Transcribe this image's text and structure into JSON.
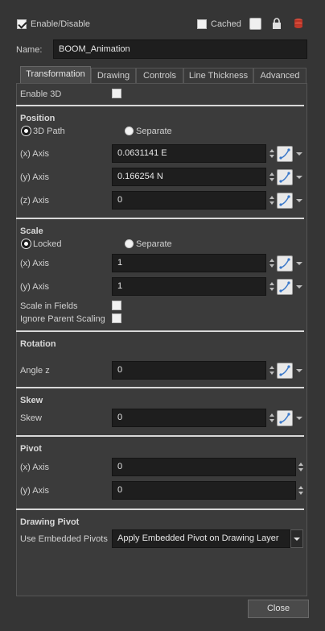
{
  "header": {
    "enable_label": "Enable/Disable",
    "enable_checked": true,
    "cached_label": "Cached"
  },
  "name": {
    "label": "Name:",
    "value": "BOOM_Animation"
  },
  "tabs": [
    {
      "label": "Transformation",
      "active": true
    },
    {
      "label": "Drawing"
    },
    {
      "label": "Controls"
    },
    {
      "label": "Line Thickness"
    },
    {
      "label": "Advanced"
    }
  ],
  "enable3d": {
    "label": "Enable 3D"
  },
  "position": {
    "title": "Position",
    "opt_3dpath": "3D Path",
    "opt_separate": "Separate",
    "x_label": "(x) Axis",
    "x_value": "0.0631141 E",
    "y_label": "(y) Axis",
    "y_value": "0.166254 N",
    "z_label": "(z) Axis",
    "z_value": "0"
  },
  "scale": {
    "title": "Scale",
    "opt_locked": "Locked",
    "opt_separate": "Separate",
    "x_label": "(x) Axis",
    "x_value": "1",
    "y_label": "(y) Axis",
    "y_value": "1",
    "fields_label": "Scale in Fields",
    "ignore_label": "Ignore Parent Scaling"
  },
  "rotation": {
    "title": "Rotation",
    "angle_label": "Angle z",
    "angle_value": "0"
  },
  "skew": {
    "title": "Skew",
    "skew_label": "Skew",
    "skew_value": "0"
  },
  "pivot": {
    "title": "Pivot",
    "x_label": "(x) Axis",
    "x_value": "0",
    "y_label": "(y) Axis",
    "y_value": "0"
  },
  "drawing_pivot": {
    "title": "Drawing Pivot",
    "label": "Use Embedded Pivots",
    "value": "Apply Embedded Pivot on Drawing Layer"
  },
  "footer": {
    "close_label": "Close"
  },
  "colors": {
    "panel": "#353535",
    "field": "#1e1e1e",
    "accent_icon": "#3a78c9",
    "stack_icon": "#c0392b"
  }
}
